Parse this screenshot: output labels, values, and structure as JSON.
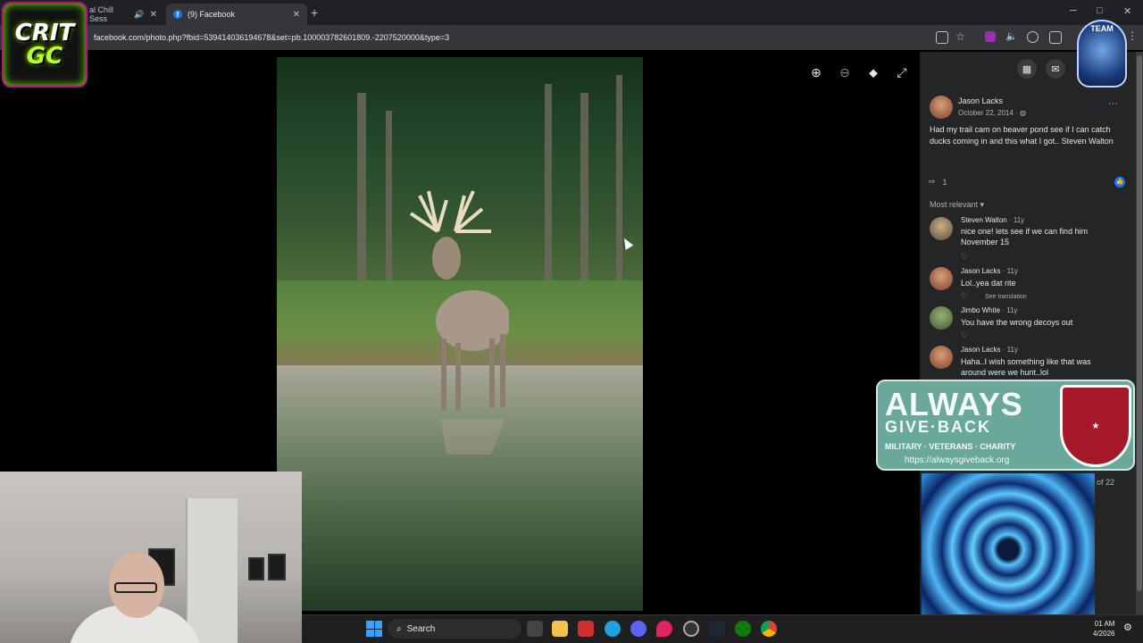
{
  "browser": {
    "tabs": [
      {
        "label": "al Chill Sess",
        "active": false
      },
      {
        "label": "(9) Facebook",
        "active": true
      }
    ],
    "new_tab": "+",
    "url": "facebook.com/photo.php?fbid=539414036194678&set=pb.100003782601809.-2207520000&type=3",
    "window_controls": {
      "minimize": "─",
      "maximize": "□",
      "close": "✕"
    }
  },
  "overlays": {
    "crit_logo_lines": [
      "CRIT",
      "GC"
    ],
    "team_logo_text": "TEAM"
  },
  "post": {
    "author": "Jason Lacks",
    "date": "October 22, 2014 · ",
    "text": "Had my trail cam on beaver pond see if I can catch ducks coming in and this what I got.. Steven Walton",
    "share_count": "1",
    "more": "···",
    "sort_label": "Most relevant",
    "comments": [
      {
        "name": "Steven Walton",
        "age": " · 11y",
        "text": "nice one! lets see if we can find him November 15"
      },
      {
        "name": "Jason Lacks",
        "age": " · 11y",
        "text": "Lol..yea dat rite",
        "translation": "See translation"
      },
      {
        "name": "Jimbo White",
        "age": " · 11y",
        "text": "You have the wrong decoys out"
      },
      {
        "name": "Jason Lacks",
        "age": " · 11y",
        "text": "Haha..I wish something like that was around were we hunt..lol"
      }
    ],
    "page_count": "of 22"
  },
  "banner": {
    "title": "ALWAYS",
    "title2": "GIVE·BACK",
    "subtitle": "MILITARY · VETERANS · CHARITY",
    "url": "https://alwaysgiveback.org"
  },
  "taskbar": {
    "search_label": "Search",
    "time": "01 AM",
    "date": "4/2026"
  },
  "colors": {
    "facebook_blue": "#1877f2",
    "panel_bg": "#242526",
    "banner_teal": "#69a89a"
  }
}
